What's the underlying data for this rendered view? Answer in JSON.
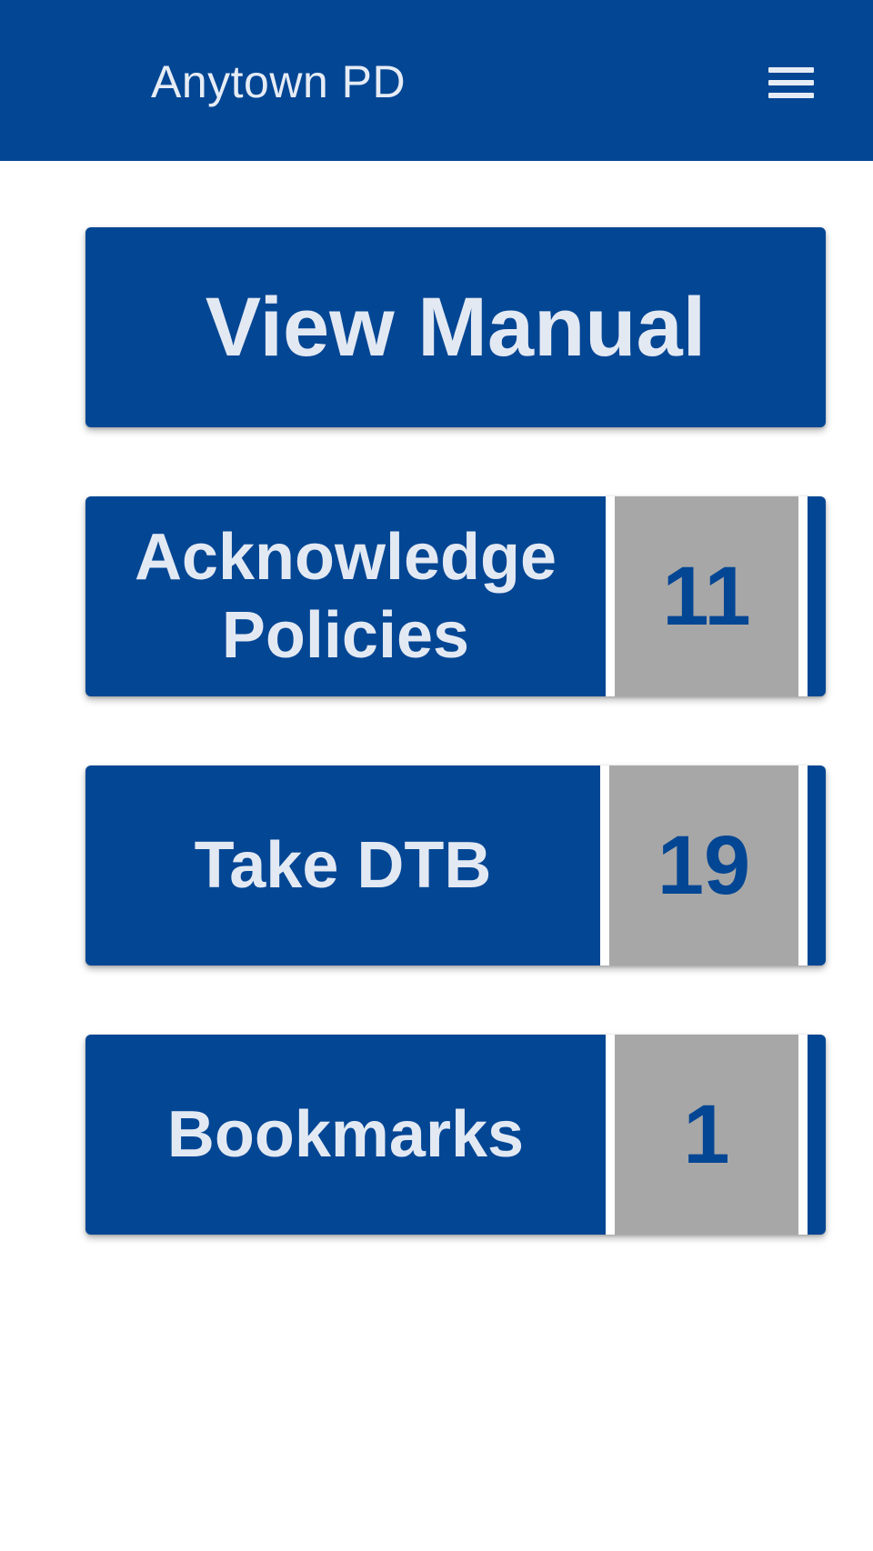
{
  "header": {
    "title": "Anytown PD",
    "menu_icon": "hamburger-menu-icon"
  },
  "main": {
    "view_manual": {
      "label": "View Manual"
    },
    "acknowledge_policies": {
      "label_line1": "Acknowledge",
      "label_line2": "Policies",
      "count": "11"
    },
    "take_dtb": {
      "label": "Take DTB",
      "count": "19"
    },
    "bookmarks": {
      "label": "Bookmarks",
      "count": "1"
    }
  },
  "colors": {
    "primary": "#034694",
    "count_background": "#a7a7a7",
    "label_text": "#e3e9f3",
    "background": "#ffffff"
  }
}
